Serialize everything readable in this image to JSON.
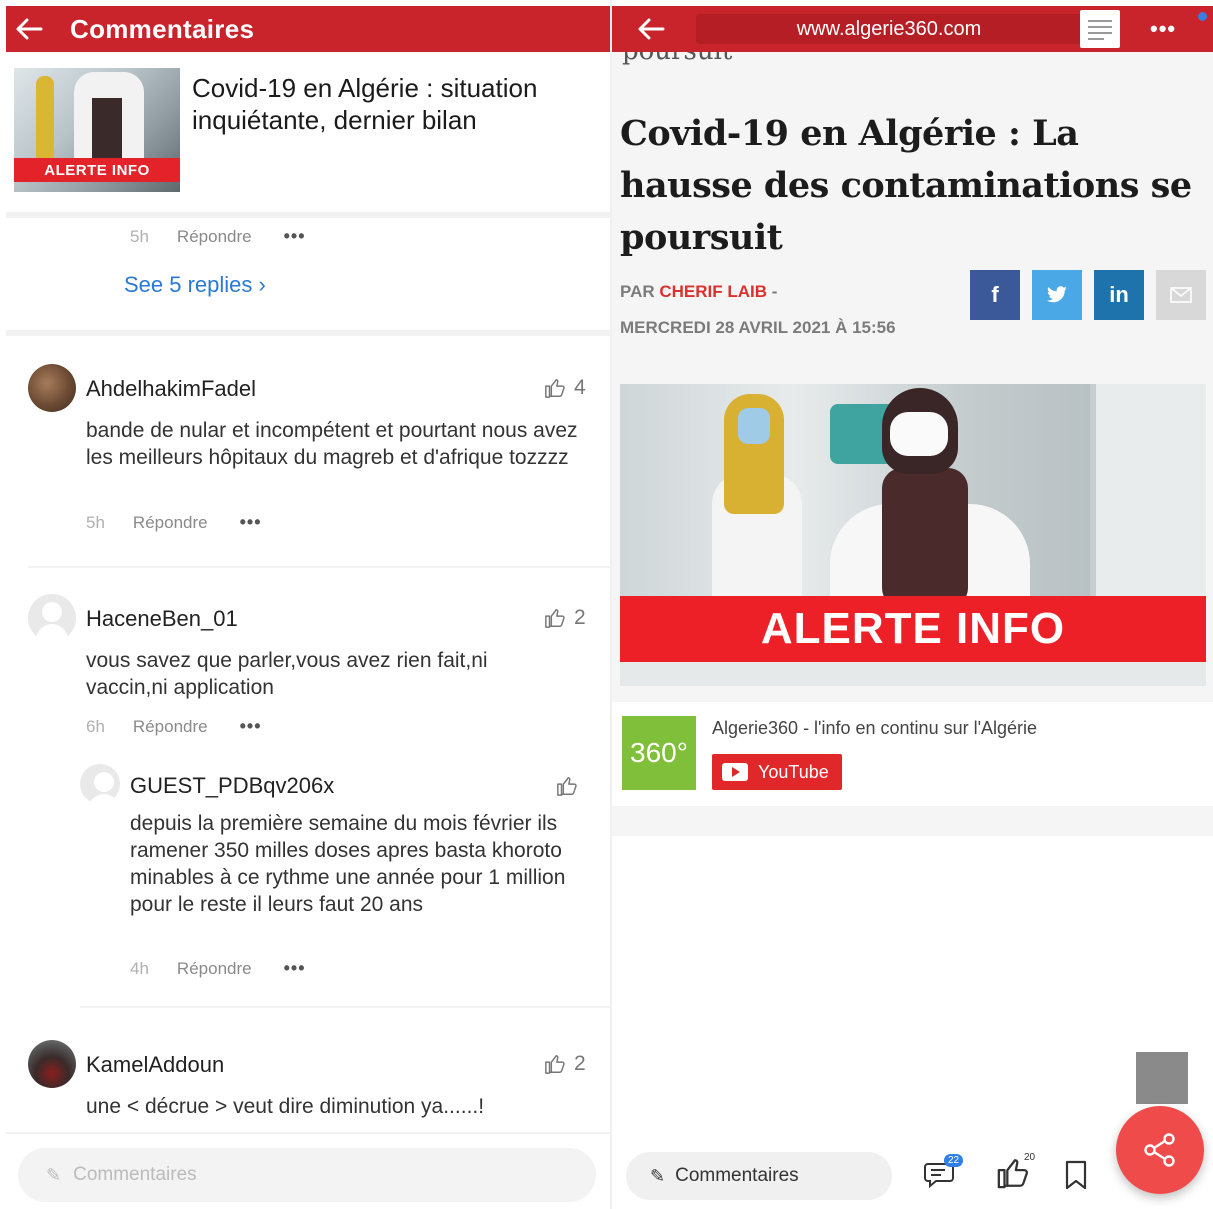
{
  "left": {
    "header": {
      "title": "Commentaires"
    },
    "article": {
      "title": "Covid-19 en Algérie : situation inquiétante, dernier bilan",
      "thumb_label": "ALERTE INFO"
    },
    "prev_meta": {
      "time": "5h",
      "reply": "Répondre",
      "more": "•••"
    },
    "see_replies": "See 5 replies ›",
    "comments": [
      {
        "user": "AhdelhakimFadel",
        "likes": "4",
        "text": "bande de nular et incompétent et pourtant nous avez les meilleurs hôpitaux du magreb et d'afrique  tozzzz",
        "time": "5h",
        "reply": "Répondre",
        "more": "•••"
      },
      {
        "user": "HaceneBen_01",
        "likes": "2",
        "text": "vous savez que parler,vous avez rien fait,ni vaccin,ni application",
        "time": "6h",
        "reply": "Répondre",
        "more": "•••"
      },
      {
        "user": "GUEST_PDBqv206x",
        "likes": "",
        "text": "depuis la première semaine du mois février ils ramener 350 milles doses apres basta khoroto minables à ce rythme une année pour 1 million pour le reste il leurs faut 20 ans",
        "time": "4h",
        "reply": "Répondre",
        "more": "•••"
      },
      {
        "user": "KamelAddoun",
        "likes": "2",
        "text": "une < décrue > veut dire diminution ya......!"
      }
    ],
    "input_placeholder": "Commentaires"
  },
  "right": {
    "header": {
      "url": "www.algerie360.com",
      "more": "•••"
    },
    "cut_text": "poursuit",
    "headline": "Covid-19 en Algérie : La hausse des contaminations se poursuit",
    "byline_prefix": "PAR ",
    "author": "CHERIF LAIB",
    "byline_suffix": " -",
    "date": "MERCREDI 28 AVRIL 2021 À 15:56",
    "share": {
      "facebook": "f",
      "twitter": "t",
      "linkedin": "in"
    },
    "hero_label": "ALERTE INFO",
    "channel": {
      "logo": "360°",
      "name": "Algerie360 - l'info en continu sur l'Algérie",
      "button": "YouTube"
    },
    "bottom": {
      "input": "Commentaires",
      "comments_count": "22",
      "likes_count": "20"
    }
  },
  "colors": {
    "brand_red": "#c9232b",
    "link_blue": "#2a79d6",
    "facebook": "#3b5998",
    "twitter": "#4aa8e6",
    "linkedin": "#1e73ad",
    "fab": "#ef4b4b"
  }
}
